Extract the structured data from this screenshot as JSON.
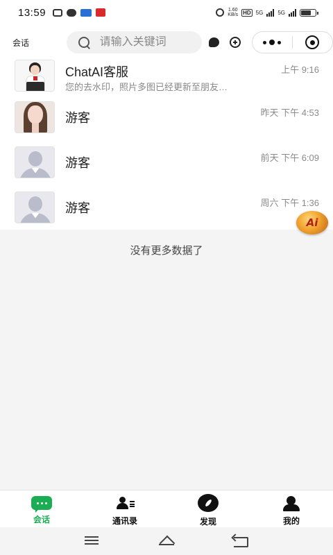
{
  "status_bar": {
    "time": "13:59",
    "net_speed_value": "1.60",
    "net_speed_unit": "KB/s",
    "hd_label": "HD",
    "network_1": "5G",
    "network_2": "5G"
  },
  "header": {
    "title": "会话",
    "search_placeholder": "请输入关键词"
  },
  "conversations": [
    {
      "name": "ChatAI客服",
      "preview": "您的去水印，照片多图已经更新至朋友…",
      "time": "上午 9:16",
      "avatar": "customer-service"
    },
    {
      "name": "游客",
      "preview": "",
      "time": "昨天 下午 4:53",
      "avatar": "girl-photo"
    },
    {
      "name": "游客",
      "preview": "",
      "time": "前天 下午 6:09",
      "avatar": "default"
    },
    {
      "name": "游客",
      "preview": "",
      "time": "周六 下午 1:36",
      "avatar": "default"
    }
  ],
  "ai_badge_label": "Ai",
  "no_more_text": "没有更多数据了",
  "tabs": [
    {
      "label": "会话",
      "icon": "chat-icon",
      "active": true
    },
    {
      "label": "通讯录",
      "icon": "contacts-icon",
      "active": false
    },
    {
      "label": "发现",
      "icon": "compass-icon",
      "active": false
    },
    {
      "label": "我的",
      "icon": "profile-icon",
      "active": false
    }
  ],
  "colors": {
    "accent": "#1aad53",
    "ai_badge": "#f1a22c"
  }
}
